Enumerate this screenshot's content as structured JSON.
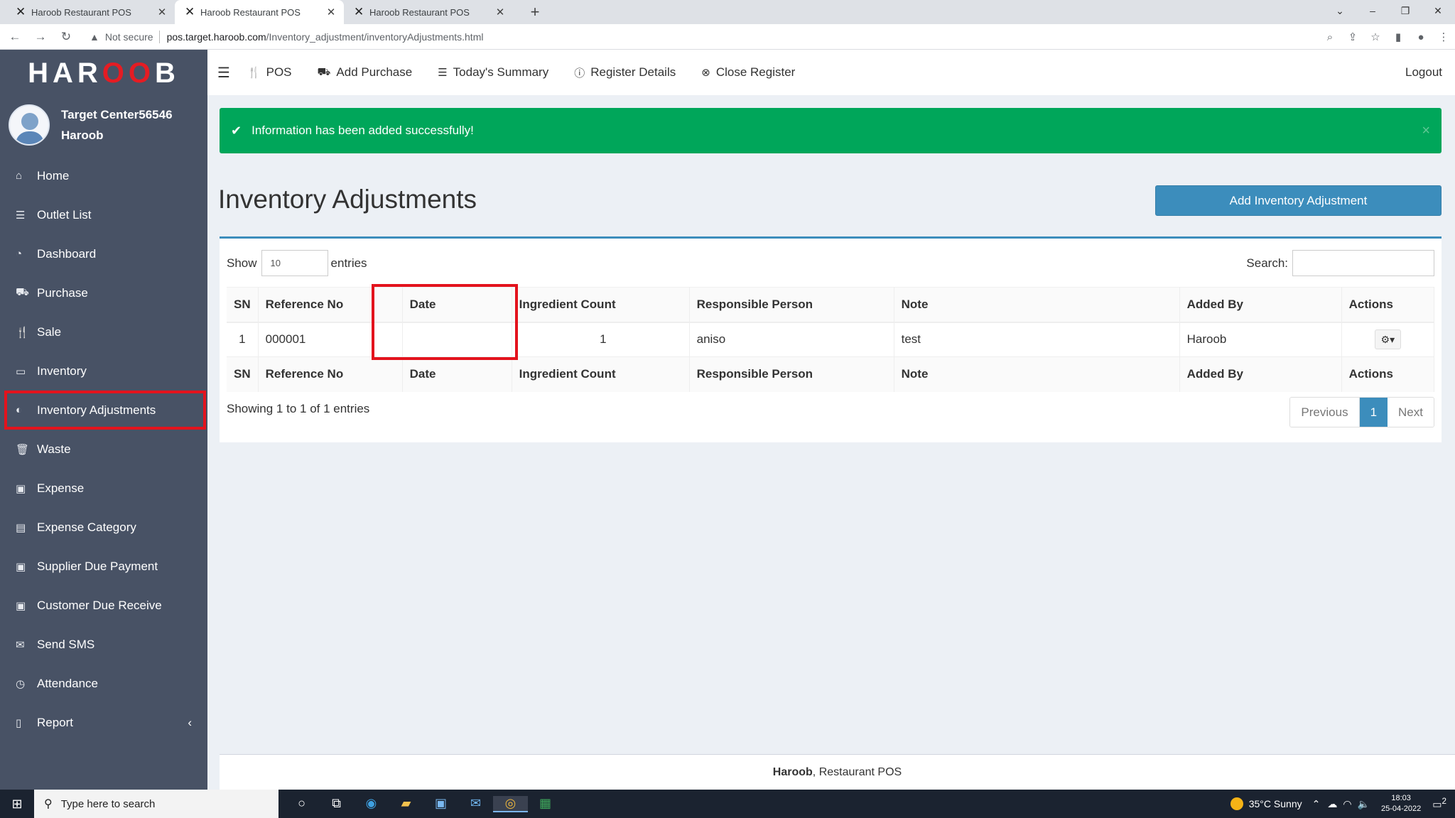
{
  "browser": {
    "tabs": [
      {
        "title": "Haroob Restaurant POS",
        "active": false
      },
      {
        "title": "Haroob Restaurant POS",
        "active": true
      },
      {
        "title": "Haroob Restaurant POS",
        "active": false
      }
    ],
    "security": "Not secure",
    "url_host": "pos.target.haroob.com",
    "url_path": "/Inventory_adjustment/inventoryAdjustments.html"
  },
  "brand": {
    "logo_left": "HAR",
    "logo_mid": "OO",
    "logo_right": "B"
  },
  "user": {
    "line1": "Target Center56546",
    "line2": "Haroob"
  },
  "sidebar": {
    "items": [
      {
        "label": "Home",
        "icon": "home-icon",
        "glyph": "⌂"
      },
      {
        "label": "Outlet List",
        "icon": "list-icon",
        "glyph": "☰"
      },
      {
        "label": "Dashboard",
        "icon": "dashboard-icon",
        "glyph": "◔"
      },
      {
        "label": "Purchase",
        "icon": "truck-icon",
        "glyph": "⛟"
      },
      {
        "label": "Sale",
        "icon": "cutlery-icon",
        "glyph": "🍴"
      },
      {
        "label": "Inventory",
        "icon": "hdd-icon",
        "glyph": "▭"
      },
      {
        "label": "Inventory Adjustments",
        "icon": "adjust-icon",
        "glyph": "◐"
      },
      {
        "label": "Waste",
        "icon": "trash-icon",
        "glyph": "🗑"
      },
      {
        "label": "Expense",
        "icon": "money-icon",
        "glyph": "▣"
      },
      {
        "label": "Expense Category",
        "icon": "list-alt-icon",
        "glyph": "▤"
      },
      {
        "label": "Supplier Due Payment",
        "icon": "money-icon",
        "glyph": "▣"
      },
      {
        "label": "Customer Due Receive",
        "icon": "money-icon",
        "glyph": "▣"
      },
      {
        "label": "Send SMS",
        "icon": "envelope-icon",
        "glyph": "✉"
      },
      {
        "label": "Attendance",
        "icon": "clock-icon",
        "glyph": "◷"
      },
      {
        "label": "Report",
        "icon": "file-icon",
        "glyph": "▯"
      }
    ]
  },
  "topnav": {
    "pos": "POS",
    "add_purchase": "Add Purchase",
    "todays_summary": "Today's Summary",
    "register_details": "Register Details",
    "close_register": "Close Register",
    "logout": "Logout"
  },
  "alert": {
    "message": "Information has been added successfully!",
    "color": "#00a65a"
  },
  "page": {
    "title": "Inventory Adjustments",
    "add_button": "Add Inventory Adjustment"
  },
  "table": {
    "show_label": "Show",
    "entries_value": "10",
    "entries_label": "entries",
    "search_label": "Search:",
    "columns": [
      "SN",
      "Reference No",
      "Date",
      "Ingredient Count",
      "Responsible Person",
      "Note",
      "Added By",
      "Actions"
    ],
    "rows": [
      {
        "sn": "1",
        "ref": "000001",
        "date": "",
        "count": "1",
        "person": "aniso",
        "note": "test",
        "added_by": "Haroob"
      }
    ],
    "info": "Showing 1 to 1 of 1 entries",
    "prev": "Previous",
    "page": "1",
    "next": "Next"
  },
  "footer": {
    "brand": "Haroob",
    "rest": ", Restaurant POS"
  },
  "taskbar": {
    "search_placeholder": "Type here to search",
    "weather": "35°C  Sunny",
    "time": "18:03",
    "date": "25-04-2022",
    "notif_count": "2"
  },
  "colors": {
    "sidebar": "#485265",
    "primary": "#3c8dbc",
    "highlight": "#e3131d"
  }
}
